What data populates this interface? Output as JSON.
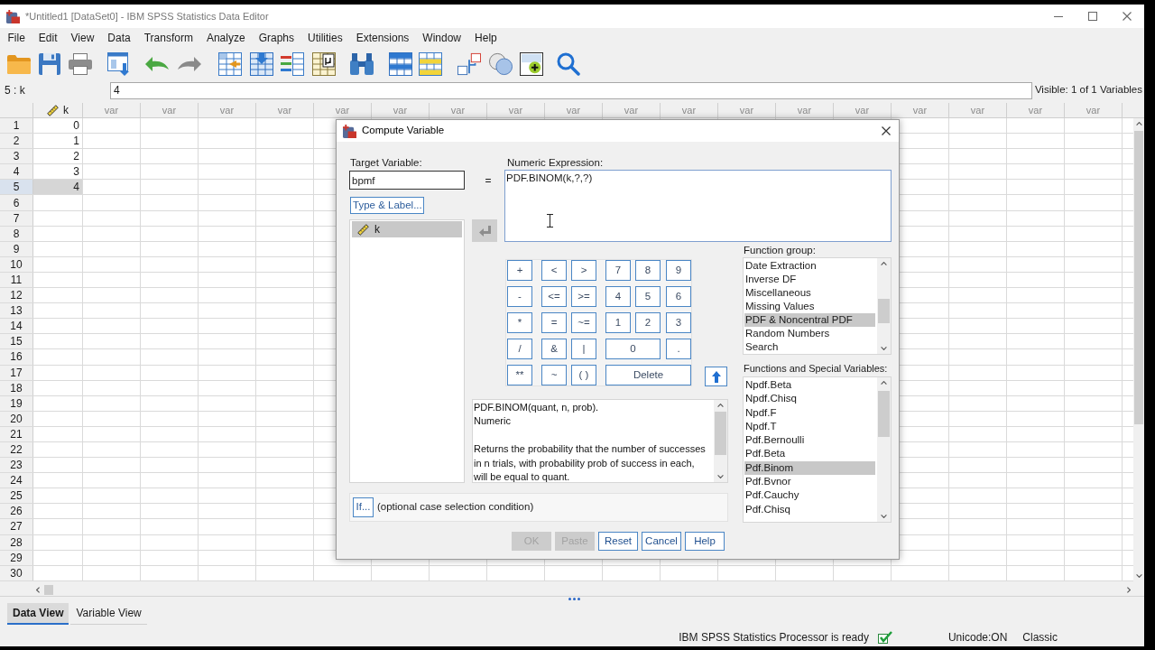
{
  "window": {
    "title": "*Untitled1 [DataSet0] - IBM SPSS Statistics Data Editor"
  },
  "menu": [
    "File",
    "Edit",
    "View",
    "Data",
    "Transform",
    "Analyze",
    "Graphs",
    "Utilities",
    "Extensions",
    "Window",
    "Help"
  ],
  "cell_editor": {
    "reference": "5 : k",
    "value": "4",
    "visible": "Visible: 1 of 1 Variables"
  },
  "grid": {
    "columns": [
      {
        "label": "k",
        "kind": "variable"
      },
      {
        "label": "var",
        "kind": "empty"
      },
      {
        "label": "var",
        "kind": "empty"
      },
      {
        "label": "var",
        "kind": "empty"
      },
      {
        "label": "var",
        "kind": "empty"
      },
      {
        "label": "var",
        "kind": "empty"
      },
      {
        "label": "var",
        "kind": "empty"
      },
      {
        "label": "var",
        "kind": "empty"
      },
      {
        "label": "var",
        "kind": "empty"
      },
      {
        "label": "var",
        "kind": "empty"
      },
      {
        "label": "var",
        "kind": "empty"
      },
      {
        "label": "var",
        "kind": "empty"
      },
      {
        "label": "var",
        "kind": "empty"
      },
      {
        "label": "var",
        "kind": "empty"
      },
      {
        "label": "var",
        "kind": "empty"
      },
      {
        "label": "var",
        "kind": "empty"
      },
      {
        "label": "var",
        "kind": "empty"
      },
      {
        "label": "var",
        "kind": "empty"
      },
      {
        "label": "var",
        "kind": "empty"
      }
    ],
    "rows": [
      {
        "number": "1",
        "selected": false,
        "value": "0"
      },
      {
        "number": "2",
        "selected": false,
        "value": "1"
      },
      {
        "number": "3",
        "selected": false,
        "value": "2"
      },
      {
        "number": "4",
        "selected": false,
        "value": "3"
      },
      {
        "number": "5",
        "selected": true,
        "value": "4"
      },
      {
        "number": "6",
        "selected": false
      },
      {
        "number": "7",
        "selected": false
      },
      {
        "number": "8",
        "selected": false
      },
      {
        "number": "9",
        "selected": false
      },
      {
        "number": "10",
        "selected": false
      },
      {
        "number": "11",
        "selected": false
      },
      {
        "number": "12",
        "selected": false
      },
      {
        "number": "13",
        "selected": false
      },
      {
        "number": "14",
        "selected": false
      },
      {
        "number": "15",
        "selected": false
      },
      {
        "number": "16",
        "selected": false
      },
      {
        "number": "17",
        "selected": false
      },
      {
        "number": "18",
        "selected": false
      },
      {
        "number": "19",
        "selected": false
      },
      {
        "number": "20",
        "selected": false
      },
      {
        "number": "21",
        "selected": false
      },
      {
        "number": "22",
        "selected": false
      },
      {
        "number": "23",
        "selected": false
      },
      {
        "number": "24",
        "selected": false
      },
      {
        "number": "25",
        "selected": false
      },
      {
        "number": "26",
        "selected": false
      },
      {
        "number": "27",
        "selected": false
      },
      {
        "number": "28",
        "selected": false
      },
      {
        "number": "29",
        "selected": false
      },
      {
        "number": "30",
        "selected": false
      }
    ]
  },
  "view_tabs": [
    {
      "label": "Data View",
      "selected": true
    },
    {
      "label": "Variable View",
      "selected": false
    }
  ],
  "status_bar": {
    "processor": "IBM SPSS Statistics Processor is ready",
    "encoding": "Unicode:ON",
    "mode": "Classic"
  },
  "dialog": {
    "title": "Compute Variable",
    "target_variable": {
      "label": "Target Variable:",
      "value": "bpmf"
    },
    "type_label_button": "Type & Label...",
    "variables": [
      {
        "name": "k",
        "selected": true
      }
    ],
    "equals": "=",
    "transfer_button": {
      "disabled": true
    },
    "expression": {
      "label": "Numeric Expression:",
      "value": "PDF.BINOM(k,?,?)"
    },
    "keypad": [
      [
        {
          "label": "+",
          "kind": "single"
        },
        {
          "label": "<",
          "kind": "single"
        },
        {
          "label": ">",
          "kind": "single"
        },
        {
          "label": "7",
          "kind": "single"
        },
        {
          "label": "8",
          "kind": "single"
        },
        {
          "label": "9",
          "kind": "single"
        }
      ],
      [
        {
          "label": "-",
          "kind": "single"
        },
        {
          "label": "<=",
          "kind": "single"
        },
        {
          "label": ">=",
          "kind": "single"
        },
        {
          "label": "4",
          "kind": "single"
        },
        {
          "label": "5",
          "kind": "single"
        },
        {
          "label": "6",
          "kind": "single"
        }
      ],
      [
        {
          "label": "*",
          "kind": "single"
        },
        {
          "label": "=",
          "kind": "single"
        },
        {
          "label": "~=",
          "kind": "single"
        },
        {
          "label": "1",
          "kind": "single"
        },
        {
          "label": "2",
          "kind": "single"
        },
        {
          "label": "3",
          "kind": "single"
        }
      ],
      [
        {
          "label": "/",
          "kind": "single"
        },
        {
          "label": "&",
          "kind": "single"
        },
        {
          "label": "|",
          "kind": "single"
        },
        {
          "label": "0",
          "kind": "double"
        },
        {
          "label": ".",
          "kind": "single"
        }
      ],
      [
        {
          "label": "**",
          "kind": "single"
        },
        {
          "label": "~",
          "kind": "single"
        },
        {
          "label": "( )",
          "kind": "single"
        },
        {
          "label": "Delete",
          "kind": "triple"
        }
      ]
    ],
    "description": {
      "signature": "PDF.BINOM(quant, n, prob).",
      "type": "Numeric",
      "text_lines": [
        "Returns the probability that the number of successes",
        "in n trials, with probability prob of success in each,",
        "will be equal to quant."
      ]
    },
    "if_button": "If...",
    "if_condition": "(optional case selection condition)",
    "function_group": {
      "label": "Function group:",
      "items": [
        {
          "label": "Date Extraction",
          "selected": false
        },
        {
          "label": "Inverse DF",
          "selected": false
        },
        {
          "label": "Miscellaneous",
          "selected": false
        },
        {
          "label": "Missing Values",
          "selected": false
        },
        {
          "label": "PDF & Noncentral PDF",
          "selected": true
        },
        {
          "label": "Random Numbers",
          "selected": false
        },
        {
          "label": "Search",
          "selected": false
        }
      ]
    },
    "functions": {
      "label": "Functions and Special Variables:",
      "items": [
        {
          "label": "Npdf.Beta",
          "selected": false
        },
        {
          "label": "Npdf.Chisq",
          "selected": false
        },
        {
          "label": "Npdf.F",
          "selected": false
        },
        {
          "label": "Npdf.T",
          "selected": false
        },
        {
          "label": "Pdf.Bernoulli",
          "selected": false
        },
        {
          "label": "Pdf.Beta",
          "selected": false
        },
        {
          "label": "Pdf.Binom",
          "selected": true
        },
        {
          "label": "Pdf.Bvnor",
          "selected": false
        },
        {
          "label": "Pdf.Cauchy",
          "selected": false
        },
        {
          "label": "Pdf.Chisq",
          "selected": false
        }
      ]
    },
    "buttons": [
      {
        "label": "OK",
        "disabled": true
      },
      {
        "label": "Paste",
        "disabled": true
      },
      {
        "label": "Reset",
        "disabled": false
      },
      {
        "label": "Cancel",
        "disabled": false
      },
      {
        "label": "Help",
        "disabled": false
      }
    ]
  }
}
